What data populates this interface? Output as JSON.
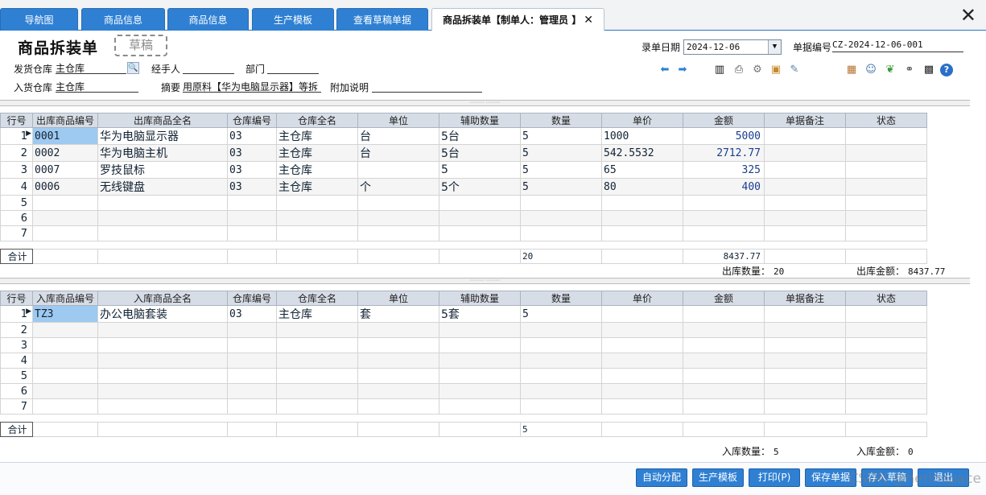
{
  "tabs": [
    {
      "label": "导航图"
    },
    {
      "label": "商品信息"
    },
    {
      "label": "商品信息"
    },
    {
      "label": "生产模板"
    },
    {
      "label": "查看草稿单据"
    },
    {
      "label": "商品拆装单【制单人：管理员 】"
    }
  ],
  "close_glyph": "✕",
  "header": {
    "title": "商品拆装单",
    "stamp": "草稿",
    "date_label": "录单日期",
    "date_value": "2024-12-06",
    "docno_label": "单据编号",
    "docno_value": "CZ-2024-12-06-001",
    "out_wh_label": "发货仓库",
    "out_wh_value": "主仓库",
    "handler_label": "经手人",
    "handler_value": "",
    "dept_label": "部门",
    "dept_value": "",
    "in_wh_label": "入货仓库",
    "in_wh_value": "主仓库",
    "summary_label": "摘要",
    "summary_value": "用原料【华为电脑显示器】等拆",
    "extra_label": "附加说明",
    "extra_value": ""
  },
  "columns_out": [
    "行号",
    "出库商品编号",
    "出库商品全名",
    "仓库编号",
    "仓库全名",
    "单位",
    "辅助数量",
    "数量",
    "单价",
    "金额",
    "单据备注",
    "状态"
  ],
  "rows_out": [
    {
      "no": "1",
      "code": "0001",
      "name": "华为电脑显示器",
      "whno": "03",
      "wh": "主仓库",
      "unit": "台",
      "aux": "5台",
      "qty": "5",
      "price": "1000",
      "amount": "5000",
      "remark": "",
      "status": ""
    },
    {
      "no": "2",
      "code": "0002",
      "name": "华为电脑主机",
      "whno": "03",
      "wh": "主仓库",
      "unit": "台",
      "aux": "5台",
      "qty": "5",
      "price": "542.5532",
      "amount": "2712.77",
      "remark": "",
      "status": ""
    },
    {
      "no": "3",
      "code": "0007",
      "name": "罗技鼠标",
      "whno": "03",
      "wh": "主仓库",
      "unit": "",
      "aux": "5",
      "qty": "5",
      "price": "65",
      "amount": "325",
      "remark": "",
      "status": ""
    },
    {
      "no": "4",
      "code": "0006",
      "name": "无线键盘",
      "whno": "03",
      "wh": "主仓库",
      "unit": "个",
      "aux": "5个",
      "qty": "5",
      "price": "80",
      "amount": "400",
      "remark": "",
      "status": ""
    },
    {
      "no": "5",
      "code": "",
      "name": "",
      "whno": "",
      "wh": "",
      "unit": "",
      "aux": "",
      "qty": "",
      "price": "",
      "amount": "",
      "remark": "",
      "status": ""
    },
    {
      "no": "6",
      "code": "",
      "name": "",
      "whno": "",
      "wh": "",
      "unit": "",
      "aux": "",
      "qty": "",
      "price": "",
      "amount": "",
      "remark": "",
      "status": ""
    },
    {
      "no": "7",
      "code": "",
      "name": "",
      "whno": "",
      "wh": "",
      "unit": "",
      "aux": "",
      "qty": "",
      "price": "",
      "amount": "",
      "remark": "",
      "status": ""
    }
  ],
  "sum_out": {
    "label": "合计",
    "qty": "20",
    "amount": "8437.77"
  },
  "totals_out": {
    "qty_label": "出库数量：",
    "qty": "20",
    "amount_label": "出库金额：",
    "amount": "8437.77"
  },
  "columns_in": [
    "行号",
    "入库商品编号",
    "入库商品全名",
    "仓库编号",
    "仓库全名",
    "单位",
    "辅助数量",
    "数量",
    "单价",
    "金额",
    "单据备注",
    "状态"
  ],
  "rows_in": [
    {
      "no": "1",
      "code": "TZ3",
      "name": "办公电脑套装",
      "whno": "03",
      "wh": "主仓库",
      "unit": "套",
      "aux": "5套",
      "qty": "5",
      "price": "",
      "amount": "",
      "remark": "",
      "status": ""
    },
    {
      "no": "2",
      "code": "",
      "name": "",
      "whno": "",
      "wh": "",
      "unit": "",
      "aux": "",
      "qty": "",
      "price": "",
      "amount": "",
      "remark": "",
      "status": ""
    },
    {
      "no": "3",
      "code": "",
      "name": "",
      "whno": "",
      "wh": "",
      "unit": "",
      "aux": "",
      "qty": "",
      "price": "",
      "amount": "",
      "remark": "",
      "status": ""
    },
    {
      "no": "4",
      "code": "",
      "name": "",
      "whno": "",
      "wh": "",
      "unit": "",
      "aux": "",
      "qty": "",
      "price": "",
      "amount": "",
      "remark": "",
      "status": ""
    },
    {
      "no": "5",
      "code": "",
      "name": "",
      "whno": "",
      "wh": "",
      "unit": "",
      "aux": "",
      "qty": "",
      "price": "",
      "amount": "",
      "remark": "",
      "status": ""
    },
    {
      "no": "6",
      "code": "",
      "name": "",
      "whno": "",
      "wh": "",
      "unit": "",
      "aux": "",
      "qty": "",
      "price": "",
      "amount": "",
      "remark": "",
      "status": ""
    },
    {
      "no": "7",
      "code": "",
      "name": "",
      "whno": "",
      "wh": "",
      "unit": "",
      "aux": "",
      "qty": "",
      "price": "",
      "amount": "",
      "remark": "",
      "status": ""
    }
  ],
  "sum_in": {
    "label": "合计",
    "qty": "5",
    "amount": ""
  },
  "totals_in": {
    "qty_label": "入库数量：",
    "qty": "5",
    "amount_label": "入库金额：",
    "amount": "0"
  },
  "buttons": [
    "自动分配",
    "生产模板",
    "打印(P)",
    "保存单据",
    "存入草稿",
    "退出"
  ],
  "watermark": "CSDN @herinspace",
  "toolbar_icons": [
    "arrow-left-icon",
    "arrow-right-icon",
    "bar-chart-icon",
    "printer-icon",
    "gear-icon",
    "box-add-icon",
    "edit-icon",
    "package-icon",
    "user-icon",
    "leaf-icon",
    "link-icon",
    "qrcode-icon",
    "help-icon"
  ],
  "colors": {
    "tab_blue": "#2f80d3",
    "header_gray": "#d7dde6",
    "selected_cell": "#9ec9f1",
    "amount_blue": "#1a3d8f"
  }
}
